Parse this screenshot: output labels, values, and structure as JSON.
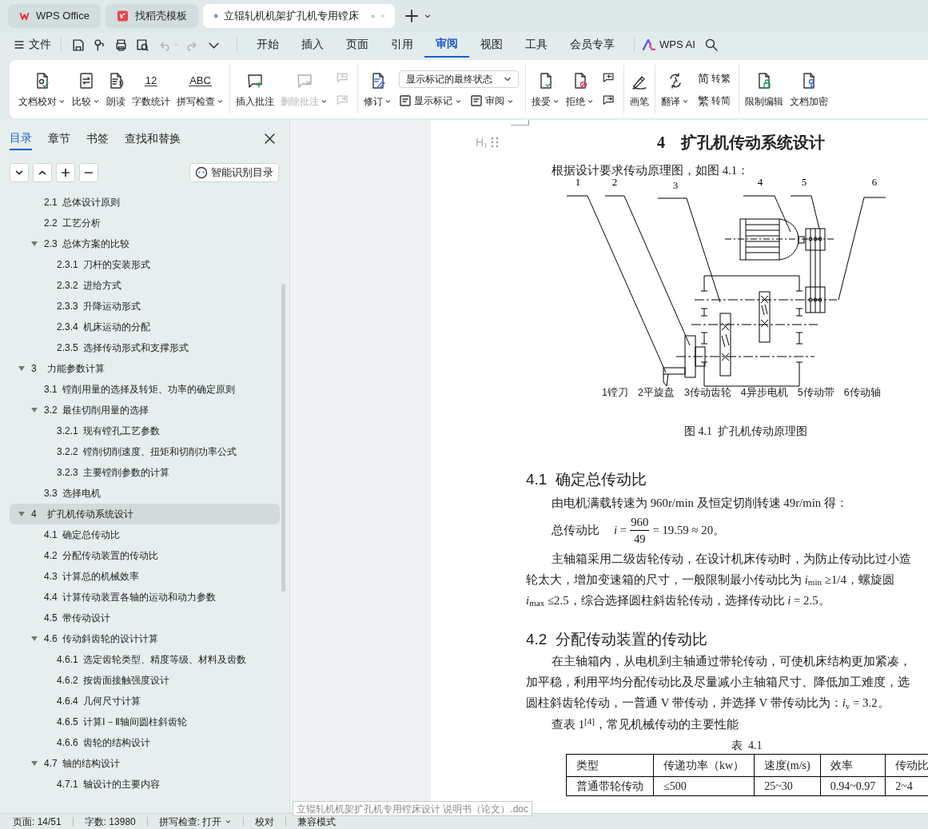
{
  "app_tabs": [
    {
      "label": "WPS Office",
      "selected": false
    },
    {
      "label": "找稻壳模板",
      "selected": false
    },
    {
      "label": "立辊轧机机架扩孔机专用镗床",
      "selected": true
    }
  ],
  "menu": {
    "file": "文件",
    "quick_access": [
      {
        "disabled": false
      },
      {
        "disabled": false
      },
      {
        "disabled": false
      },
      {
        "disabled": false
      },
      {
        "disabled": true,
        "dropdown": true
      },
      {
        "disabled": true
      },
      {
        "disabled": false
      }
    ],
    "tabs": [
      {
        "label": "开始",
        "selected": false
      },
      {
        "label": "插入",
        "selected": false
      },
      {
        "label": "页面",
        "selected": false
      },
      {
        "label": "引用",
        "selected": false
      },
      {
        "label": "审阅",
        "selected": true
      },
      {
        "label": "视图",
        "selected": false
      },
      {
        "label": "工具",
        "selected": false
      },
      {
        "label": "会员专享",
        "selected": false
      }
    ],
    "ai": "WPS AI"
  },
  "ribbon": {
    "groups": [
      {
        "items": [
          {
            "kind": "large",
            "label": "文档校对",
            "dropdown": true,
            "disabled": false
          },
          {
            "kind": "large",
            "label": "比较",
            "dropdown": true,
            "disabled": false
          },
          {
            "kind": "large",
            "label": "朗读",
            "disabled": false
          },
          {
            "kind": "large",
            "label": "字数统计",
            "glyph": "12",
            "disabled": false
          },
          {
            "kind": "large",
            "label": "拼写检查",
            "glyph": "ABC",
            "dropdown": true,
            "disabled": false
          }
        ]
      },
      {
        "items": [
          {
            "kind": "large",
            "label": "插入批注",
            "disabled": false
          },
          {
            "kind": "large",
            "label": "删除批注",
            "dropdown": true,
            "disabled": true
          },
          {
            "kind": "pair",
            "disabled": true
          }
        ]
      },
      {
        "items": [
          {
            "kind": "large",
            "label": "修订",
            "dropdown": true,
            "disabled": false
          },
          {
            "kind": "stack",
            "select": "显示标记的最终状态",
            "buttons": [
              {
                "label": "显示标记",
                "dropdown": true
              },
              {
                "label": "审阅",
                "dropdown": true
              }
            ]
          }
        ]
      },
      {
        "items": [
          {
            "kind": "large",
            "label": "接受",
            "dropdown": true,
            "disabled": false
          },
          {
            "kind": "large",
            "label": "拒绝",
            "dropdown": true,
            "disabled": false
          },
          {
            "kind": "pair",
            "disabled": false
          }
        ]
      },
      {
        "items": [
          {
            "kind": "large",
            "label": "画笔",
            "disabled": false
          }
        ]
      },
      {
        "items": [
          {
            "kind": "large",
            "label": "翻译",
            "dropdown": true,
            "disabled": false
          },
          {
            "kind": "glyphs",
            "buttons": [
              {
                "glyph": "简",
                "label": "转繁"
              },
              {
                "glyph": "繁",
                "label": "转简"
              }
            ]
          }
        ]
      },
      {
        "items": [
          {
            "kind": "large",
            "label": "限制编辑",
            "disabled": false
          },
          {
            "kind": "large",
            "label": "文档加密",
            "disabled": false
          }
        ]
      }
    ]
  },
  "sidebar": {
    "tabs": [
      {
        "label": "目录",
        "selected": true
      },
      {
        "label": "章节",
        "selected": false
      },
      {
        "label": "书签",
        "selected": false
      },
      {
        "label": "查找和替换",
        "selected": false
      }
    ],
    "smart_button": "智能识别目录",
    "toc": {
      "continued": [
        {
          "label": "2.1  总体设计原则",
          "selected": false
        },
        {
          "label": "2.2  工艺分析",
          "selected": false
        },
        {
          "label": "2.3  总体方案的比较",
          "selected": false,
          "expanded": true,
          "children": [
            {
              "label": "2.3.1  刀杆的安装形式",
              "selected": false
            },
            {
              "label": "2.3.2  进给方式",
              "selected": false
            },
            {
              "label": "2.3.3  升降运动形式",
              "selected": false
            },
            {
              "label": "2.3.4  机床运动的分配",
              "selected": false
            },
            {
              "label": "2.3.5  选择传动形式和支撑形式",
              "selected": false
            }
          ]
        }
      ],
      "items": [
        {
          "label": "3    力能参数计算",
          "selected": false,
          "expanded": true,
          "children": [
            {
              "label": "3.1  镗削用量的选择及转矩、功率的确定原则",
              "selected": false
            },
            {
              "label": "3.2  最佳切削用量的选择",
              "selected": false,
              "expanded": true,
              "children": [
                {
                  "label": "3.2.1  现有镗孔工艺参数",
                  "selected": false
                },
                {
                  "label": "3.2.2  镗削切削速度、扭矩和切削功率公式",
                  "selected": false
                },
                {
                  "label": "3.2.3  主要镗削参数的计算",
                  "selected": false
                }
              ]
            },
            {
              "label": "3.3  选择电机",
              "selected": false
            }
          ]
        },
        {
          "label": "4    扩孔机传动系统设计",
          "selected": true,
          "expanded": true,
          "children": [
            {
              "label": "4.1  确定总传动比",
              "selected": false
            },
            {
              "label": "4.2  分配传动装置的传动比",
              "selected": false
            },
            {
              "label": "4.3  计算总的机械效率",
              "selected": false
            },
            {
              "label": "4.4  计算传动装置各轴的运动和动力参数",
              "selected": false
            },
            {
              "label": "4.5  带传动设计",
              "selected": false
            },
            {
              "label": "4.6  传动斜齿轮的设计计算",
              "selected": false,
              "expanded": true,
              "children": [
                {
                  "label": "4.6.1  选定齿轮类型、精度等级、材料及齿数",
                  "selected": false
                },
                {
                  "label": "4.6.2  按齿面接触强度设计",
                  "selected": false
                },
                {
                  "label": "4.6.4  几何尺寸计算",
                  "selected": false
                },
                {
                  "label": "4.6.5  计算Ⅰ－Ⅱ轴间圆柱斜齿轮",
                  "selected": false
                },
                {
                  "label": "4.6.6  齿轮的结构设计",
                  "selected": false
                }
              ]
            },
            {
              "label": "4.7  轴的结构设计",
              "selected": false,
              "expanded": true,
              "children": [
                {
                  "label": "4.7.1  轴设计的主要内容",
                  "selected": false
                }
              ]
            }
          ]
        }
      ]
    }
  },
  "document": {
    "heading_marker": "H₁",
    "title": "4　扩孔机传动系统设计",
    "intro": "根据设计要求传动原理图，如图 4.1：",
    "figure": {
      "callouts": [
        "1",
        "2",
        "3",
        "4",
        "5",
        "6"
      ],
      "legend": [
        "1镗刀",
        "2平旋盘",
        "3传动齿轮",
        "4异步电机",
        "5传动带",
        "6传动轴"
      ],
      "caption": "图 4.1  扩孔机传动原理图"
    },
    "section_1": {
      "heading": "4.1  确定总传动比",
      "line_1": "由电机满载转速为 960r/min 及恒定切削转速 49r/min 得：",
      "formula": {
        "lead": "总传动比",
        "lhs": "*i* =",
        "numerator": "960",
        "denominator": "49",
        "rhs": "= 19.59 ≈ 20。"
      },
      "lines": [
        "主轴箱采用二级齿轮传动，在设计机床传动时，为防止传动比过小造",
        "轮太大，增加变速箱的尺寸，一般限制最小传动比为 *i*$_{min}$ ≥1/4，螺旋圆",
        "*i*$_{max}$ ≤2.5，综合选择圆柱斜齿轮传动，选择传动比 *i* = 2.5。"
      ]
    },
    "section_2": {
      "heading": "4.2  分配传动装置的传动比",
      "lines": [
        "在主轴箱内，从电机到主轴通过带轮传动，可使机床结构更加紧凑，",
        "加平稳，利用平均分配传动比及尽量减小主轴箱尺寸、降低加工难度，选",
        "圆柱斜齿轮传动，一普通 V 带传动，并选择 V 带传动比为：*i*$_{v}$ = 3.2。"
      ],
      "table_ref": "查表 1$^{[4]}$，常见机械传动的主要性能",
      "table": {
        "caption": "表  4.1",
        "columns": [
          "类型",
          "传递功率（kw）",
          "速度(m/s)",
          "效率",
          "传动比"
        ],
        "rows": [
          [
            "普通带轮传动",
            "≤500",
            "25~30",
            "0.94~0.97",
            "2~4"
          ]
        ]
      }
    }
  },
  "tooltip": "立辊轧机机架扩孔机专用镗床设计 说明书（论文）.doc",
  "status_bar": [
    {
      "label": "页面: 14/51"
    },
    {
      "label": "字数: 13980"
    },
    {
      "label": "拼写检查: 打开",
      "dropdown": true
    },
    {
      "label": "校对"
    },
    {
      "label": "兼容模式"
    }
  ]
}
